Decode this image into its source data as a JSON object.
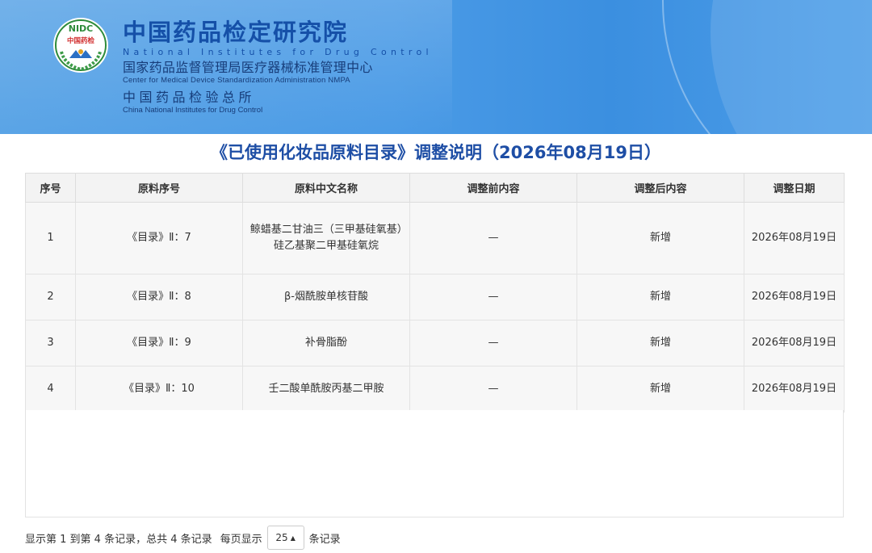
{
  "header": {
    "logo_text": "NIDC",
    "logo_sub": "中国药检",
    "title_cn": "中国药品检定研究院",
    "title_en": "National Institutes for Drug Control",
    "center_cn": "国家药品监督管理局医疗器械标准管理中心",
    "center_en": "Center for Medical Device Standardization Administration NMPA",
    "inst_cn": "中国药品检验总所",
    "inst_en": "China National Institutes for Drug Control"
  },
  "page_title": "《已使用化妆品原料目录》调整说明（2026年08月19日）",
  "table": {
    "columns": [
      "序号",
      "原料序号",
      "原料中文名称",
      "调整前内容",
      "调整后内容",
      "调整日期"
    ],
    "rows": [
      {
        "no": "1",
        "ref": "《目录》Ⅱ：7",
        "name": "鲸蜡基二甘油三（三甲基硅氧基）硅乙基聚二甲基硅氧烷",
        "before": "—",
        "after": "新增",
        "date": "2026年08月19日"
      },
      {
        "no": "2",
        "ref": "《目录》Ⅱ：8",
        "name": "β-烟酰胺单核苷酸",
        "before": "—",
        "after": "新增",
        "date": "2026年08月19日"
      },
      {
        "no": "3",
        "ref": "《目录》Ⅱ：9",
        "name": "补骨脂酚",
        "before": "—",
        "after": "新增",
        "date": "2026年08月19日"
      },
      {
        "no": "4",
        "ref": "《目录》Ⅱ：10",
        "name": "壬二酸单酰胺丙基二甲胺",
        "before": "—",
        "after": "新增",
        "date": "2026年08月19日"
      }
    ]
  },
  "pagination": {
    "summary": "显示第 1 到第 4 条记录，总共 4 条记录",
    "per_page_prefix": "每页显示",
    "per_page_value": "25",
    "per_page_suffix": "条记录"
  },
  "colors": {
    "header_blue": "#4b9be6",
    "title_blue": "#1e4ea5",
    "logo_green": "#2e8b3a"
  }
}
